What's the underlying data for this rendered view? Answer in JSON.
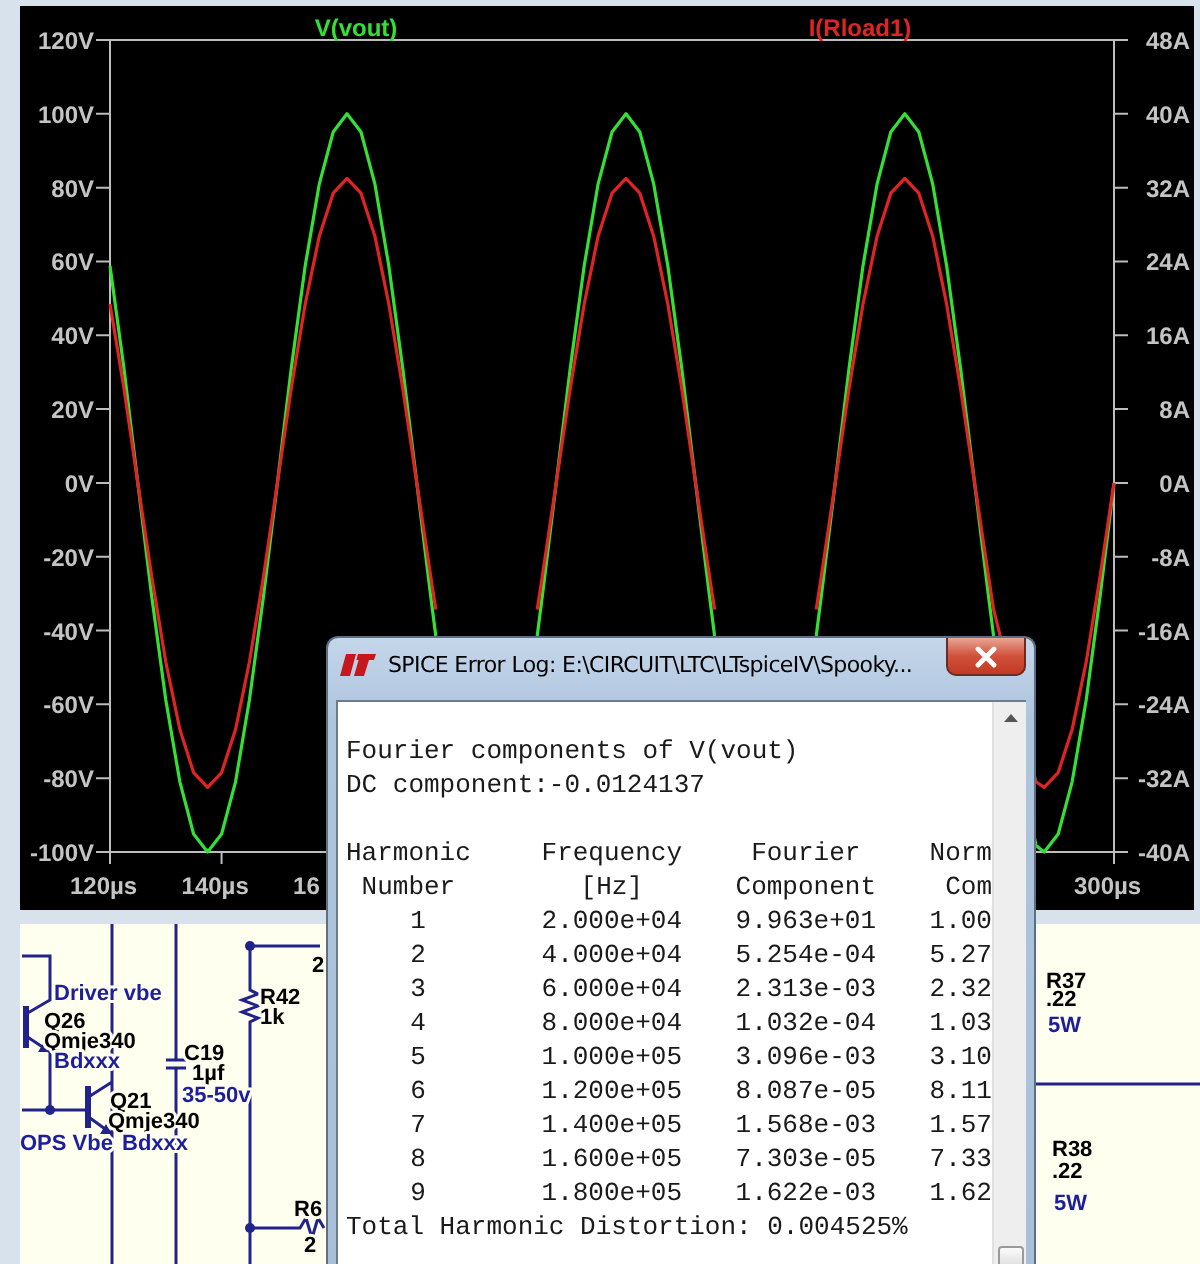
{
  "plot": {
    "chart_data": {
      "type": "line",
      "xlim": [
        120,
        300
      ],
      "ylim": [
        -100,
        120
      ],
      "y2lim": [
        -40,
        48
      ],
      "xticks": [
        {
          "value": 120,
          "label": "120µs"
        },
        {
          "value": 140,
          "label": "140µs"
        },
        {
          "value": 300,
          "label": "300µs"
        }
      ],
      "yticks": [
        {
          "value": 120,
          "label": "120V"
        },
        {
          "value": 100,
          "label": "100V"
        },
        {
          "value": 80,
          "label": "80V"
        },
        {
          "value": 60,
          "label": "60V"
        },
        {
          "value": 40,
          "label": "40V"
        },
        {
          "value": 20,
          "label": "20V"
        },
        {
          "value": 0,
          "label": "0V"
        },
        {
          "value": -20,
          "label": "-20V"
        },
        {
          "value": -40,
          "label": "-40V"
        },
        {
          "value": -60,
          "label": "-60V"
        },
        {
          "value": -80,
          "label": "-80V"
        },
        {
          "value": -100,
          "label": "-100V"
        }
      ],
      "y2ticks": [
        {
          "value": 48,
          "label": "48A"
        },
        {
          "value": 40,
          "label": "40A"
        },
        {
          "value": 32,
          "label": "32A"
        },
        {
          "value": 24,
          "label": "24A"
        },
        {
          "value": 16,
          "label": "16A"
        },
        {
          "value": 8,
          "label": "8A"
        },
        {
          "value": 0,
          "label": "0A"
        },
        {
          "value": -8,
          "label": "-8A"
        },
        {
          "value": -16,
          "label": "-16A"
        },
        {
          "value": -24,
          "label": "-24A"
        },
        {
          "value": -32,
          "label": "-32A"
        },
        {
          "value": -40,
          "label": "-40A"
        }
      ],
      "x": [
        120,
        122.5,
        125,
        127.5,
        130,
        132.5,
        135,
        137.5,
        140,
        142.5,
        145,
        147.5,
        150,
        152.5,
        155,
        157.5,
        160,
        162.5,
        165,
        167.5,
        170,
        172.5,
        175,
        177.5,
        178.4,
        187.5,
        196.6,
        197.5,
        200,
        202.5,
        205,
        207.5,
        210,
        212.5,
        215,
        217.5,
        220,
        222.5,
        225,
        227.5,
        228.4,
        237.5,
        246.6,
        247.5,
        250,
        252.5,
        255,
        257.5,
        260,
        262.5,
        265,
        267.5,
        270,
        272.5,
        275,
        277.5,
        278.4,
        286,
        287.5,
        290,
        292.5,
        295,
        297.5,
        300
      ],
      "series": [
        {
          "name": "V(vout)",
          "color": "#33e033",
          "values": [
            58.8,
            30.9,
            0,
            -30.9,
            -58.8,
            -80.9,
            -95.1,
            -100,
            -95.1,
            -80.9,
            -58.8,
            -30.9,
            0,
            30.9,
            58.8,
            80.9,
            95.1,
            100,
            95.1,
            80.9,
            58.8,
            30.9,
            0,
            -30.9,
            -41.5,
            null,
            -41.5,
            -30.9,
            0,
            30.9,
            58.8,
            80.9,
            95.1,
            100,
            95.1,
            80.9,
            58.8,
            30.9,
            0,
            -30.9,
            -41.5,
            null,
            -41.5,
            -30.9,
            0,
            30.9,
            58.8,
            80.9,
            95.1,
            100,
            95.1,
            80.9,
            58.8,
            30.9,
            0,
            -30.9,
            -41.5,
            -98.2,
            -100,
            -95.1,
            -80.9,
            -58.8,
            -30.9,
            0
          ]
        },
        {
          "name": "I(Rload1)",
          "color": "#e02424",
          "axis": "y2",
          "values": [
            19.4,
            10.2,
            0,
            -10.2,
            -19.4,
            -26.7,
            -31.4,
            -33,
            -31.4,
            -26.7,
            -19.4,
            -10.2,
            0,
            10.2,
            19.4,
            26.7,
            31.4,
            33,
            31.4,
            26.7,
            19.4,
            10.2,
            0,
            -10.2,
            -13.7,
            null,
            -13.7,
            -10.2,
            0,
            10.2,
            19.4,
            26.7,
            31.4,
            33,
            31.4,
            26.7,
            19.4,
            10.2,
            0,
            -10.2,
            -13.7,
            null,
            -13.7,
            -10.2,
            0,
            10.2,
            19.4,
            26.7,
            31.4,
            33,
            31.4,
            26.7,
            19.4,
            10.2,
            0,
            -10.2,
            -13.7,
            -32.4,
            -33,
            -31.4,
            -26.7,
            -19.4,
            -10.2,
            0
          ]
        }
      ]
    },
    "partial_x_label": "16"
  },
  "schematic": {
    "labels": [
      {
        "text": "Driver vbe",
        "kind": "comment"
      },
      {
        "text": "Q26",
        "kind": "part"
      },
      {
        "text": "Qmje340",
        "kind": "part"
      },
      {
        "text": "Bdxxx",
        "kind": "comment"
      },
      {
        "text": "C19",
        "kind": "part"
      },
      {
        "text": "1µf",
        "kind": "part"
      },
      {
        "text": "35-50v",
        "kind": "comment"
      },
      {
        "text": "Q21",
        "kind": "part"
      },
      {
        "text": "Qmje340",
        "kind": "part"
      },
      {
        "text": "OPS Vbe",
        "kind": "comment"
      },
      {
        "text": "Bdxxx",
        "kind": "comment"
      },
      {
        "text": "R42",
        "kind": "part"
      },
      {
        "text": "1k",
        "kind": "part"
      },
      {
        "text": "2",
        "kind": "part"
      },
      {
        "text": "R6",
        "kind": "part"
      },
      {
        "text": "2",
        "kind": "part"
      },
      {
        "text": "R37",
        "kind": "part"
      },
      {
        "text": ".22",
        "kind": "part"
      },
      {
        "text": "5W",
        "kind": "comment"
      },
      {
        "text": "R38",
        "kind": "part"
      },
      {
        "text": ".22",
        "kind": "part"
      },
      {
        "text": "5W",
        "kind": "comment"
      }
    ]
  },
  "log_window": {
    "title": "SPICE Error Log: E:\\CIRCUIT\\LTC\\LTspiceIV\\Spooky...",
    "lines": [
      "Fourier components of V(vout)",
      "DC component:-0.0124137"
    ],
    "columns": [
      "Harmonic\nNumber",
      "Frequency\n[Hz]",
      "Fourier\nComponent",
      "Norm\nCom"
    ],
    "rows": [
      [
        "1",
        "2.000e+04",
        "9.963e+01",
        "1.00"
      ],
      [
        "2",
        "4.000e+04",
        "5.254e-04",
        "5.27"
      ],
      [
        "3",
        "6.000e+04",
        "2.313e-03",
        "2.32"
      ],
      [
        "4",
        "8.000e+04",
        "1.032e-04",
        "1.03"
      ],
      [
        "5",
        "1.000e+05",
        "3.096e-03",
        "3.10"
      ],
      [
        "6",
        "1.200e+05",
        "8.087e-05",
        "8.11"
      ],
      [
        "7",
        "1.400e+05",
        "1.568e-03",
        "1.57"
      ],
      [
        "8",
        "1.600e+05",
        "7.303e-05",
        "7.33"
      ],
      [
        "9",
        "1.800e+05",
        "1.622e-03",
        "1.62"
      ]
    ],
    "summary": "Total Harmonic Distortion: 0.004525%"
  }
}
